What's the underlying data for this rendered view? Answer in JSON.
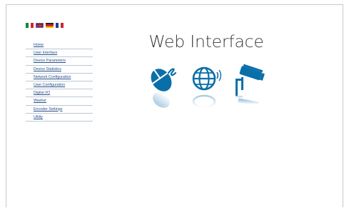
{
  "page": {
    "title": "Web Interface"
  },
  "languages": [
    {
      "name": "italian-flag-icon"
    },
    {
      "name": "uk-flag-icon"
    },
    {
      "name": "german-flag-icon"
    },
    {
      "name": "french-flag-icon"
    }
  ],
  "menu": {
    "items": [
      {
        "label": "Home"
      },
      {
        "label": "User Interface"
      },
      {
        "label": "Device Parameters"
      },
      {
        "label": "Device Statistics"
      },
      {
        "label": "Network Configuration"
      },
      {
        "label": "User Configuration"
      },
      {
        "label": "Digital I/O"
      },
      {
        "label": "Washer"
      },
      {
        "label": "Encoder Settings"
      },
      {
        "label": "Utility"
      }
    ]
  },
  "icons": [
    "mouse-icon",
    "globe-icon",
    "security-camera-icon"
  ],
  "colors": {
    "accent": "#0a6fa8",
    "link": "#2a4e8a",
    "divider": "#b9c9d6"
  }
}
